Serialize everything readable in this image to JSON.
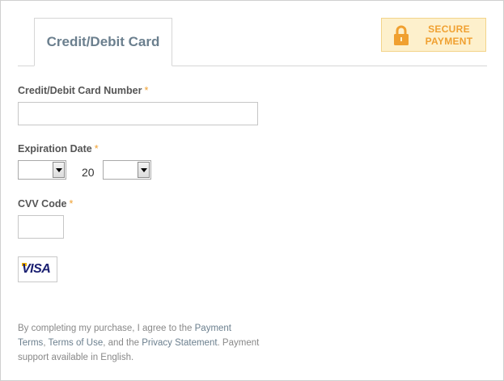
{
  "tab": {
    "label": "Credit/Debit Card"
  },
  "secure_badge": {
    "line1": "SECURE",
    "line2": "PAYMENT",
    "icon": "lock-icon"
  },
  "card_number": {
    "label": "Credit/Debit Card Number",
    "required_mark": "*",
    "value": ""
  },
  "expiration": {
    "label": "Expiration Date",
    "required_mark": "*",
    "month_value": "",
    "year_prefix": "20",
    "year_value": ""
  },
  "cvv": {
    "label": "CVV Code",
    "required_mark": "*",
    "value": ""
  },
  "card_logo": {
    "text": "VISA"
  },
  "legal": {
    "part1": "By completing my purchase, I agree to the ",
    "link1": "Payment Terms",
    "part2": ", ",
    "link2": "Terms of Use",
    "part3": ", and the ",
    "link3": "Privacy Statement",
    "part4": ". Payment support available in English."
  },
  "colors": {
    "accent_text": "#6b7f8e",
    "required": "#f0a030",
    "badge_bg": "#fdf0cc",
    "badge_text": "#f0a030"
  }
}
